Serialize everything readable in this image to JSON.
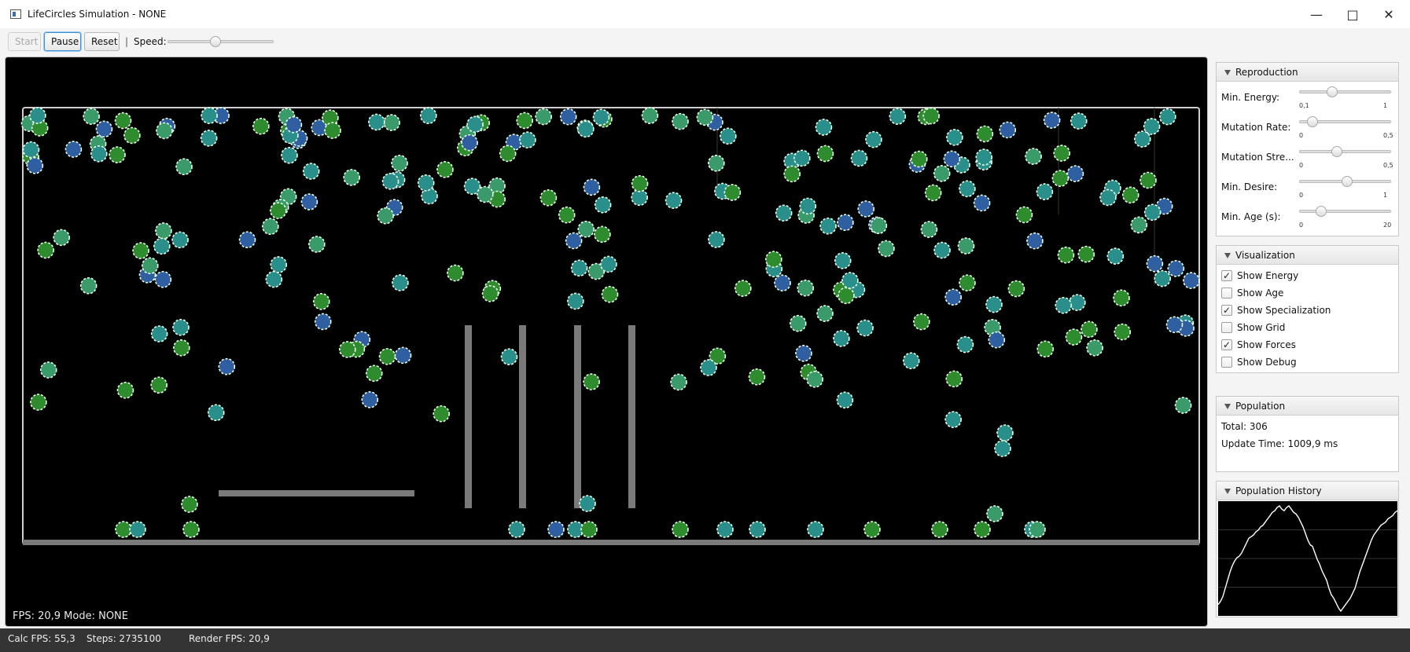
{
  "window": {
    "title": "LifeCircles Simulation - NONE"
  },
  "toolbar": {
    "start": "Start",
    "pause": "Pause",
    "reset": "Reset",
    "separator": "|",
    "speed_label": "Speed:",
    "speed": 0.45
  },
  "canvas": {
    "status": "FPS: 20,9  Mode: NONE"
  },
  "reproduction": {
    "title": "Reproduction",
    "sliders": [
      {
        "label": "Min. Energy:",
        "min": "0,1",
        "max": "1",
        "value": 0.34
      },
      {
        "label": "Mutation Rate:",
        "min": "0",
        "max": "0,5",
        "value": 0.1
      },
      {
        "label": "Mutation Stre...",
        "min": "0",
        "max": "0,5",
        "value": 0.4
      },
      {
        "label": "Min. Desire:",
        "min": "0",
        "max": "1",
        "value": 0.52
      },
      {
        "label": "Min. Age (s):",
        "min": "0",
        "max": "20",
        "value": 0.2
      }
    ]
  },
  "visualization": {
    "title": "Visualization",
    "options": [
      {
        "label": "Show Energy",
        "checked": true
      },
      {
        "label": "Show Age",
        "checked": false
      },
      {
        "label": "Show Specialization",
        "checked": true
      },
      {
        "label": "Show Grid",
        "checked": false
      },
      {
        "label": "Show Forces",
        "checked": true
      },
      {
        "label": "Show Debug",
        "checked": false
      }
    ]
  },
  "population": {
    "title": "Population",
    "total": "Total: 306",
    "update_time": "Update Time: 1009,9 ms"
  },
  "history": {
    "title": "Population History",
    "values": [
      10,
      14,
      20,
      30,
      40,
      50,
      58,
      64,
      68,
      70,
      74,
      80,
      86,
      92,
      94,
      96,
      100,
      102,
      106,
      108,
      112,
      116,
      120,
      124,
      126,
      130,
      132,
      128,
      126,
      130,
      132,
      128,
      124,
      122,
      118,
      112,
      106,
      98,
      90,
      84,
      82,
      74,
      66,
      60,
      52,
      46,
      40,
      30,
      22,
      18,
      12,
      6,
      2,
      6,
      10,
      14,
      18,
      24,
      30,
      40,
      50,
      58,
      66,
      74,
      82,
      90,
      96,
      100,
      104,
      108,
      110,
      112,
      116,
      118,
      120,
      124,
      126
    ]
  },
  "statusbar": {
    "calc_fps": "Calc FPS: 55,3",
    "steps": "Steps: 2735100",
    "render_fps": "Render FPS: 20,9"
  },
  "icons": {
    "minimize": "minimize-icon",
    "maximize": "maximize-icon",
    "close": "close-icon"
  },
  "colors": {
    "canvas_bg": "#000000",
    "cell_green": "#2e8b2e",
    "cell_teal": "#2a8f8a",
    "cell_blue": "#2f5fa0",
    "wall": "#7a7a7a"
  }
}
